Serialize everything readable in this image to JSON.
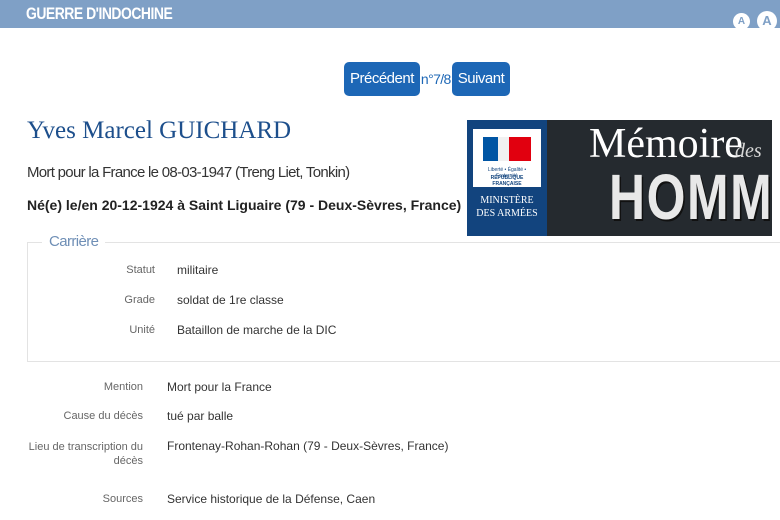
{
  "header": {
    "title": "GUERRE D'INDOCHINE",
    "font_small": "A",
    "font_large": "A",
    "color": "#7fa0c6"
  },
  "pager": {
    "prev_label": "Précédent",
    "position": "n°7/8",
    "next_label": "Suivant",
    "color": "#1d67b6"
  },
  "person": {
    "name": "Yves Marcel GUICHARD",
    "death": "Mort pour la France le 08-03-1947 (Treng Liet, Tonkin)",
    "birth": "Né(e) le/en 20-12-1924 à Saint Liguaire (79 - Deux-Sèvres, France)"
  },
  "logo": {
    "motto": "Liberté • Égalité • Fraternité",
    "republic": "RÉPUBLIQUE FRANÇAISE",
    "ministry_line1": "MINISTÈRE",
    "ministry_line2": "DES ARMÉES",
    "memoire": "Mémoire",
    "des": "des",
    "hommes": "HOMMES"
  },
  "career": {
    "legend": "Carrière",
    "fields": [
      {
        "label": "Statut",
        "value": "militaire"
      },
      {
        "label": "Grade",
        "value": "soldat de 1re classe"
      },
      {
        "label": "Unité",
        "value": "Bataillon de marche de la DIC"
      }
    ]
  },
  "details": [
    {
      "label": "Mention",
      "value": "Mort pour la France"
    },
    {
      "label": "Cause du décès",
      "value": "tué par balle"
    },
    {
      "label_line1": "Lieu de transcription du",
      "label_line2": "décès",
      "value": "Frontenay-Rohan-Rohan (79 - Deux-Sèvres, France)"
    },
    {
      "label": "Sources",
      "value": "Service historique de la Défense, Caen"
    }
  ]
}
